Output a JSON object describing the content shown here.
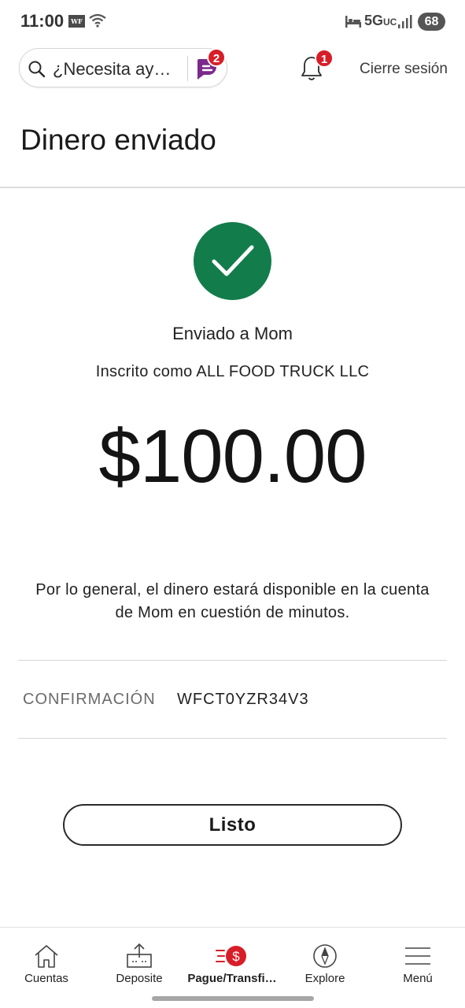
{
  "status_bar": {
    "time": "11:00",
    "app_logo": "WF",
    "network": "5G",
    "network_suffix": "UC",
    "battery": "68"
  },
  "header": {
    "search_placeholder": "¿Necesita ay…",
    "assistant_badge": "2",
    "notification_badge": "1",
    "signout_label": "Cierre sesión"
  },
  "page": {
    "title": "Dinero enviado"
  },
  "confirmation": {
    "sent_to": "Enviado a Mom",
    "registered_as": "Inscrito como ALL FOOD TRUCK LLC",
    "amount": "$100.00",
    "note": "Por lo general, el dinero estará disponible en la cuenta de Mom en cuestión de minutos.",
    "label": "CONFIRMACIÓN",
    "code": "WFCT0YZR34V3",
    "done_label": "Listo"
  },
  "nav": {
    "items": [
      {
        "label": "Cuentas",
        "icon": "home-icon"
      },
      {
        "label": "Deposite",
        "icon": "deposit-icon"
      },
      {
        "label": "Pague/Transfi…",
        "icon": "pay-transfer-icon"
      },
      {
        "label": "Explore",
        "icon": "compass-icon"
      },
      {
        "label": "Menú",
        "icon": "menu-icon"
      }
    ]
  },
  "colors": {
    "success": "#127c4b",
    "badge": "#d71e28",
    "assistant": "#7b2a8c"
  }
}
